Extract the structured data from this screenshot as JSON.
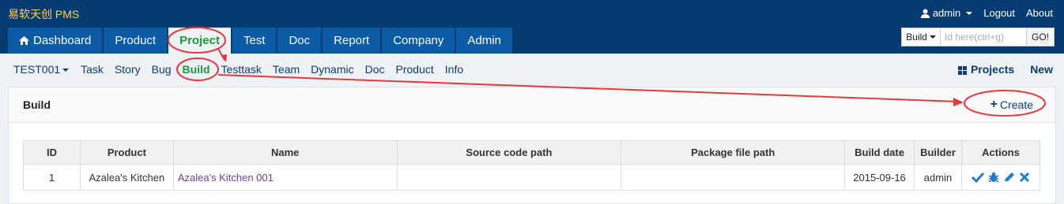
{
  "app": {
    "brand": "易软天创 PMS"
  },
  "user": {
    "name": "admin",
    "logout": "Logout",
    "about": "About"
  },
  "tabs": [
    {
      "label": "Dashboard",
      "icon": "home-icon"
    },
    {
      "label": "Product"
    },
    {
      "label": "Project",
      "active": true
    },
    {
      "label": "Test"
    },
    {
      "label": "Doc"
    },
    {
      "label": "Report"
    },
    {
      "label": "Company"
    },
    {
      "label": "Admin"
    }
  ],
  "search": {
    "type": "Build",
    "placeholder": "Id here(ctrl+g)",
    "go": "GO!"
  },
  "subnav": {
    "project": "TEST001",
    "items": [
      "Task",
      "Story",
      "Bug",
      "Build",
      "Testtask",
      "Team",
      "Dynamic",
      "Doc",
      "Product",
      "Info"
    ],
    "active": "Build",
    "projects": "Projects",
    "new": "New"
  },
  "panel": {
    "title": "Build",
    "create": "Create"
  },
  "table": {
    "headers": [
      "ID",
      "Product",
      "Name",
      "Source code path",
      "Package file path",
      "Build date",
      "Builder",
      "Actions"
    ],
    "rows": [
      {
        "id": "1",
        "product": "Azalea's Kitchen",
        "name": "Azalea's Kitchen 001",
        "source": "",
        "package": "",
        "date": "2015-09-16",
        "builder": "admin"
      }
    ]
  },
  "colors": {
    "topbar": "#053b73",
    "tab": "#0a5aa4",
    "active": "#179a35",
    "annotation": "#e8393a",
    "brand": "#ffd451"
  }
}
